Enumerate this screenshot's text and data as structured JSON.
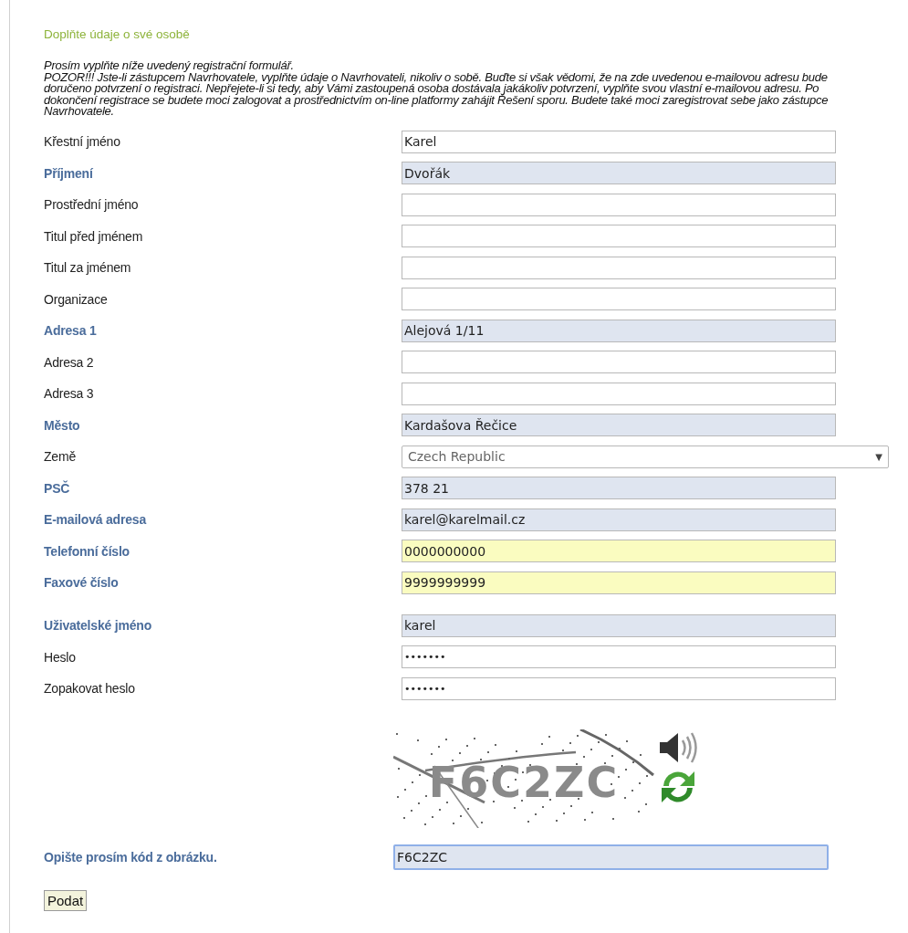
{
  "heading": "Doplňte údaje o své osobě",
  "intro": [
    "Prosím vyplňte níže uvedený registrační formulář.",
    "POZOR!!! Jste-li zástupcem Navrhovatele, vyplňte údaje o Navrhovateli, nikoliv o sobě. Buďte si však vědomi, že na zde uvedenou e-mailovou adresu bude doručeno potvrzení o registraci. Nepřejete-li si tedy, aby Vámi zastoupená osoba dostávala jakákoliv potvrzení, vyplňte svou vlastní e-mailovou adresu. Po dokončení registrace se budete moci zalogovat a prostřednictvím on-line platformy zahájit Řešení sporu. Budete také moci zaregistrovat sebe jako zástupce Navrhovatele."
  ],
  "contact_fields": [
    {
      "label": "Křestní jméno",
      "kind": "text",
      "required": false,
      "tinted": false,
      "autofilled": false,
      "value": "Karel"
    },
    {
      "label": "Příjmení",
      "kind": "text",
      "required": true,
      "tinted": true,
      "autofilled": false,
      "value": "Dvořák"
    },
    {
      "label": "Prostřední jméno",
      "kind": "text",
      "required": false,
      "tinted": false,
      "autofilled": false
    },
    {
      "label": "Titul před jménem",
      "kind": "text",
      "required": false,
      "tinted": false,
      "autofilled": false
    },
    {
      "label": "Titul za jménem",
      "kind": "text",
      "required": false,
      "tinted": false,
      "autofilled": false
    },
    {
      "label": "Organizace",
      "kind": "text",
      "required": false,
      "tinted": false,
      "autofilled": false
    },
    {
      "label": "Adresa 1",
      "kind": "text",
      "required": true,
      "tinted": true,
      "autofilled": false,
      "value": "Alejová 1/11"
    },
    {
      "label": "Adresa 2",
      "kind": "text",
      "required": false,
      "tinted": false,
      "autofilled": false
    },
    {
      "label": "Adresa 3",
      "kind": "text",
      "required": false,
      "tinted": false,
      "autofilled": false
    },
    {
      "label": "Město",
      "kind": "text",
      "required": true,
      "tinted": true,
      "autofilled": false,
      "value": "Kardašova Řečice"
    },
    {
      "label": "Země",
      "kind": "select",
      "required": false,
      "tinted": false,
      "autofilled": false,
      "value": "Czech Republic",
      "arrow": "▼"
    },
    {
      "label": "PSČ",
      "kind": "text",
      "required": true,
      "tinted": true,
      "autofilled": false,
      "value": "378 21"
    },
    {
      "label": "E-mailová adresa",
      "kind": "text",
      "required": true,
      "tinted": true,
      "autofilled": false,
      "value": "karel@karelmail.cz"
    },
    {
      "label": "Telefonní číslo",
      "kind": "text",
      "required": true,
      "tinted": false,
      "autofilled": true,
      "value": "0000000000"
    },
    {
      "label": "Faxové číslo",
      "kind": "text",
      "required": true,
      "tinted": false,
      "autofilled": true,
      "value": "9999999999"
    }
  ],
  "account_fields": [
    {
      "label": "Uživatelské jméno",
      "kind": "text",
      "required": true,
      "tinted": true,
      "autofilled": false,
      "value": "karel"
    },
    {
      "label": "Heslo",
      "kind": "password",
      "required": false,
      "tinted": false,
      "autofilled": false,
      "value": "•••••••"
    },
    {
      "label": "Zopakovat heslo",
      "kind": "password",
      "required": false,
      "tinted": false,
      "autofilled": false,
      "value": "•••••••"
    }
  ],
  "captcha": {
    "code": "F6C2ZC",
    "label": "Opište prosím kód z obrázku.",
    "answer": "F6C2ZC",
    "focused": true
  },
  "submit": "Podat"
}
